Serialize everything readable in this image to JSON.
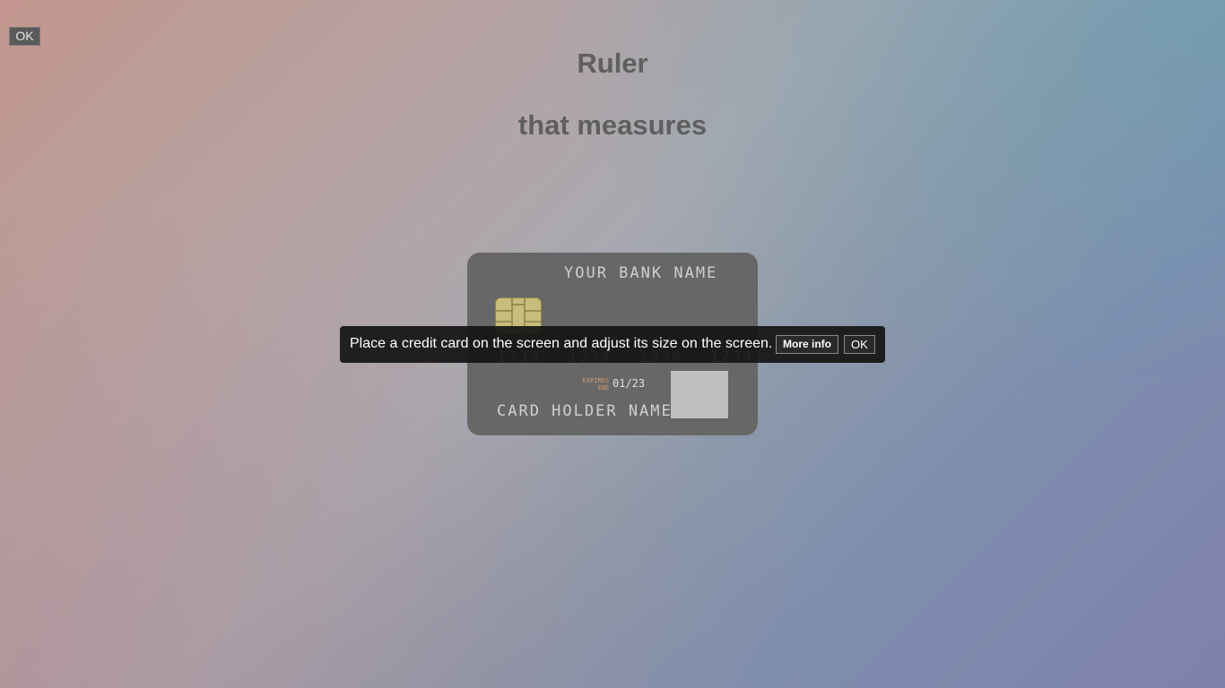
{
  "corner_button": {
    "label": "OK"
  },
  "header": {
    "title_line1": "Ruler",
    "title_line2": "that measures"
  },
  "card": {
    "bank_name": "YOUR BANK NAME",
    "number": "1234 1234 1234 1234",
    "expires_label_line1": "EXPIRES",
    "expires_label_line2": "END",
    "expiry_date": "01/23",
    "holder_name": "CARD HOLDER NAME"
  },
  "toast": {
    "message": "Place a credit card on the screen and adjust its size on the screen.",
    "more_info_label": "More info",
    "ok_label": "OK"
  },
  "colors": {
    "card": "#676767",
    "chip": "#c9bd7c",
    "toast_bg": "#141414",
    "title": "#5f5f5f"
  }
}
